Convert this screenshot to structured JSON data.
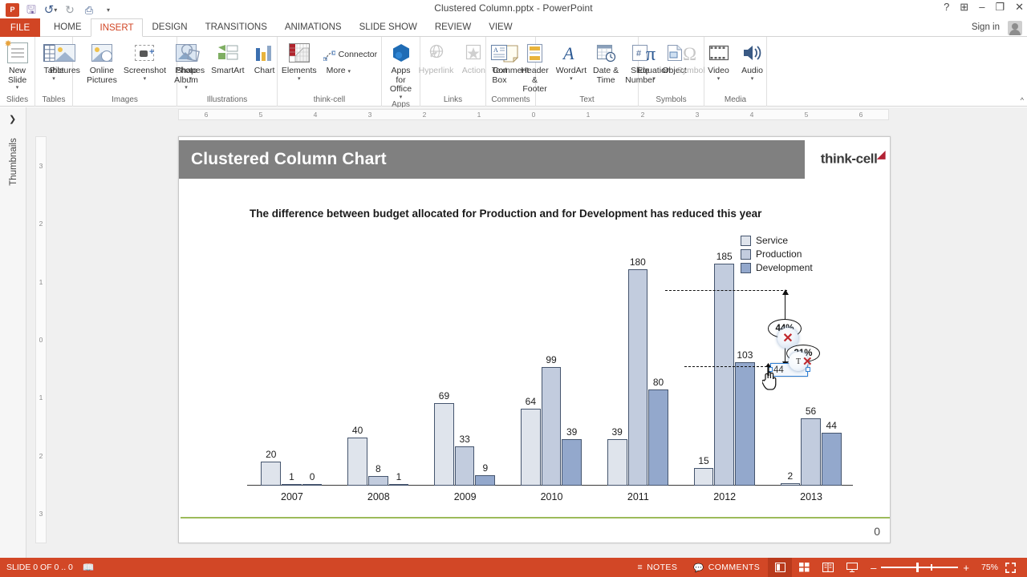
{
  "window": {
    "title": "Clustered Column.pptx - PowerPoint",
    "quick_access": [
      {
        "name": "powerpoint-logo",
        "label": "P"
      },
      {
        "name": "save-icon",
        "label": "Save"
      },
      {
        "name": "undo-icon",
        "label": "Undo"
      },
      {
        "name": "redo-icon",
        "label": "Redo"
      },
      {
        "name": "start-presentation-icon",
        "label": "Start From Beginning"
      },
      {
        "name": "customize-qat-icon",
        "label": "Customize Quick Access Toolbar"
      }
    ],
    "controls": {
      "help": "?",
      "ribbon_display": "⊞",
      "minimize": "–",
      "restore": "❐",
      "close": "✕"
    },
    "sign_in": "Sign in"
  },
  "tabs": {
    "file": "FILE",
    "items": [
      "HOME",
      "INSERT",
      "DESIGN",
      "TRANSITIONS",
      "ANIMATIONS",
      "SLIDE SHOW",
      "REVIEW",
      "VIEW"
    ],
    "active": "INSERT"
  },
  "ribbon": {
    "groups": [
      {
        "label": "Slides",
        "items": [
          {
            "label": "New\nSlide",
            "caret": true
          }
        ]
      },
      {
        "label": "Tables",
        "items": [
          {
            "label": "Table",
            "caret": true
          }
        ]
      },
      {
        "label": "Images",
        "items": [
          {
            "label": "Pictures",
            "caret": false
          },
          {
            "label": "Online\nPictures",
            "caret": false
          },
          {
            "label": "Screenshot",
            "caret": true
          },
          {
            "label": "Photo\nAlbum",
            "caret": true
          }
        ]
      },
      {
        "label": "Illustrations",
        "items": [
          {
            "label": "Shapes",
            "caret": true
          },
          {
            "label": "SmartArt",
            "caret": false
          },
          {
            "label": "Chart",
            "caret": false
          }
        ]
      },
      {
        "label": "think-cell",
        "items": [
          {
            "label": "Elements",
            "caret": true
          },
          {
            "label": "Connector",
            "caret": false
          },
          {
            "label": "More",
            "caret": true
          }
        ]
      },
      {
        "label": "Apps",
        "items": [
          {
            "label": "Apps for\nOffice",
            "caret": true
          }
        ]
      },
      {
        "label": "Links",
        "items": [
          {
            "label": "Hyperlink",
            "caret": false,
            "disabled": true
          },
          {
            "label": "Action",
            "caret": false,
            "disabled": true
          }
        ]
      },
      {
        "label": "Comments",
        "items": [
          {
            "label": "Comment",
            "caret": false
          }
        ]
      },
      {
        "label": "Text",
        "items": [
          {
            "label": "Text\nBox",
            "caret": false
          },
          {
            "label": "Header\n& Footer",
            "caret": false
          },
          {
            "label": "WordArt",
            "caret": true
          },
          {
            "label": "Date &\nTime",
            "caret": false
          },
          {
            "label": "Slide\nNumber",
            "caret": false
          },
          {
            "label": "Object",
            "caret": false
          }
        ]
      },
      {
        "label": "Symbols",
        "items": [
          {
            "label": "Equation",
            "caret": true
          },
          {
            "label": "Symbol",
            "caret": false,
            "disabled": true
          }
        ]
      },
      {
        "label": "Media",
        "items": [
          {
            "label": "Video",
            "caret": true
          },
          {
            "label": "Audio",
            "caret": true
          }
        ]
      }
    ],
    "collapse_icon": "^"
  },
  "panes": {
    "thumbnails_label": "Thumbnails",
    "thumbnails_chevron": "❯"
  },
  "rulers": {
    "horizontal": [
      "6",
      "5",
      "4",
      "3",
      "2",
      "1",
      "0",
      "1",
      "2",
      "3",
      "4",
      "5",
      "6"
    ],
    "vertical": [
      "3",
      "2",
      "1",
      "0",
      "1",
      "2",
      "3"
    ]
  },
  "slide": {
    "title": "Clustered Column Chart",
    "brand": "think-cell",
    "brand_mark": "◢",
    "page_number": "0",
    "accent_color": "#9cbb5a",
    "title_bg": "#808080"
  },
  "chart_data": {
    "type": "bar",
    "title": "The difference between budget allocated for Production and for Development has reduced this year",
    "xlabel": "",
    "ylabel": "",
    "ylim": [
      0,
      200
    ],
    "grid": false,
    "legend_position": "top-right",
    "categories": [
      "2007",
      "2008",
      "2009",
      "2010",
      "2011",
      "2012",
      "2013"
    ],
    "series": [
      {
        "name": "Service",
        "color": "#dfe4ec",
        "values": [
          20,
          40,
          69,
          64,
          39,
          15,
          2
        ]
      },
      {
        "name": "Production",
        "color": "#c2ccde",
        "values": [
          1,
          8,
          33,
          99,
          180,
          185,
          56
        ]
      },
      {
        "name": "Development",
        "color": "#93a8cc",
        "values": [
          0,
          1,
          9,
          39,
          80,
          103,
          44
        ]
      }
    ],
    "annotations": [
      {
        "type": "difference-arrow",
        "label": "44%",
        "from_value": 103,
        "to_value": 185,
        "category": "2012"
      },
      {
        "type": "difference-arrow",
        "label": "21%",
        "from_value": 44,
        "to_value": 56,
        "category": "2013"
      }
    ]
  },
  "overlay": {
    "edit_value": "44",
    "delete_icon": "✕",
    "text_icon": "T",
    "text_delete_icon": "✕",
    "bubble_label": "21%"
  },
  "statusbar": {
    "slide_info": "SLIDE 0 OF 0 .. 0",
    "language_icon": "proofing-icon",
    "notes": "NOTES",
    "comments": "COMMENTS",
    "views": [
      "normal-view",
      "slide-sorter-view",
      "reading-view",
      "slide-show-view"
    ],
    "zoom_out": "–",
    "zoom_in": "+",
    "zoom_level": "75%",
    "fit_icon": "⛶",
    "bg_color": "#d24726"
  }
}
